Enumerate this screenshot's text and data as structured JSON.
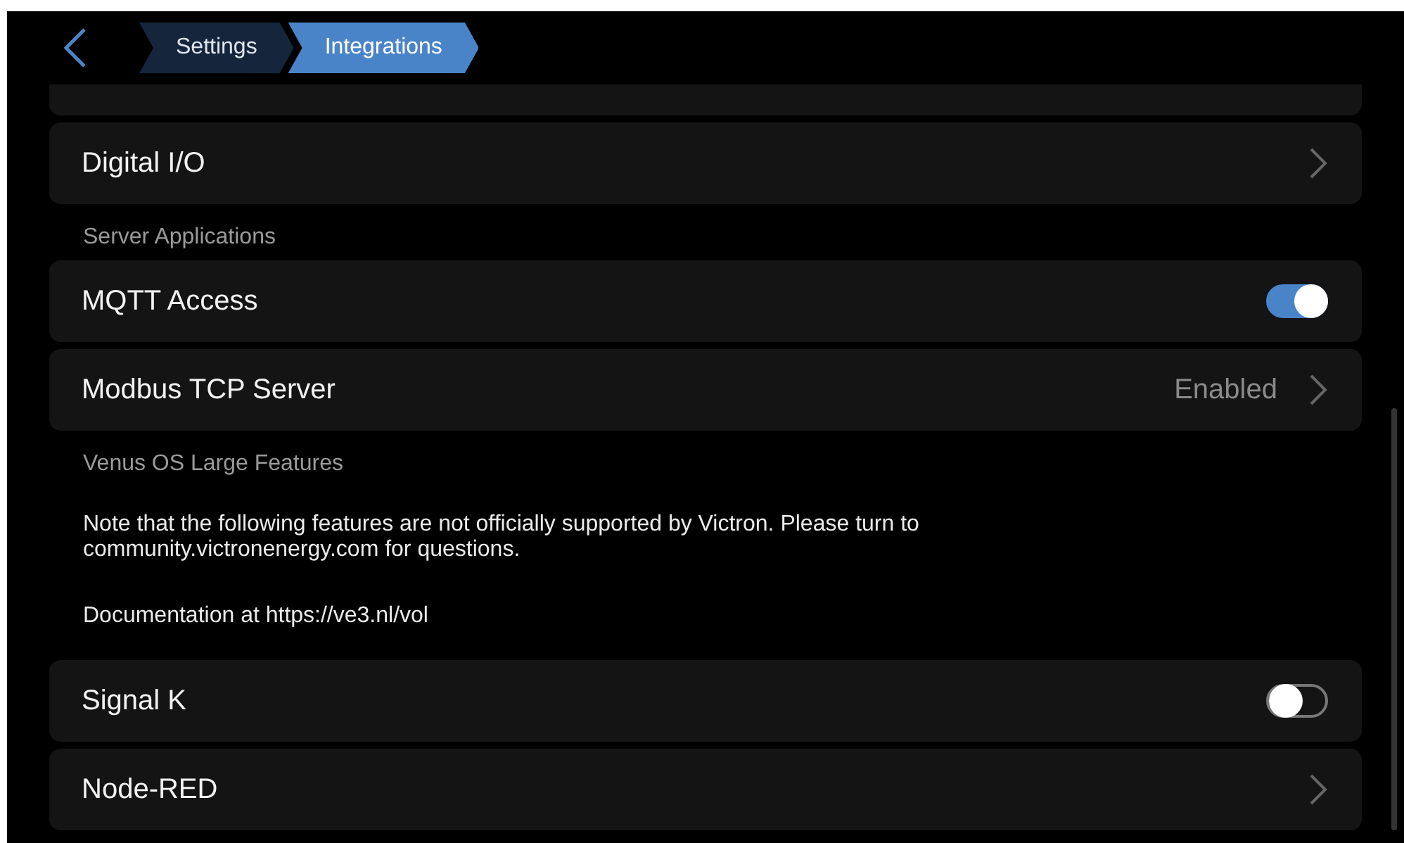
{
  "breadcrumbs": [
    {
      "label": "Settings",
      "selected": false
    },
    {
      "label": "Integrations",
      "selected": true
    }
  ],
  "items": [
    {
      "kind": "cut"
    },
    {
      "kind": "link",
      "label": "Digital I/O"
    },
    {
      "kind": "header",
      "label": "Server Applications"
    },
    {
      "kind": "toggle",
      "label": "MQTT Access",
      "on": true
    },
    {
      "kind": "link",
      "label": "Modbus TCP Server",
      "value": "Enabled"
    },
    {
      "kind": "header",
      "label": "Venus OS Large Features"
    },
    {
      "kind": "note",
      "label": "Note that the following features are not officially supported by Victron. Please turn to community.victronenergy.com for questions."
    },
    {
      "kind": "note",
      "label": "Documentation at https://ve3.nl/vol"
    },
    {
      "kind": "toggle",
      "label": "Signal K",
      "on": false
    },
    {
      "kind": "link",
      "label": "Node-RED"
    }
  ]
}
